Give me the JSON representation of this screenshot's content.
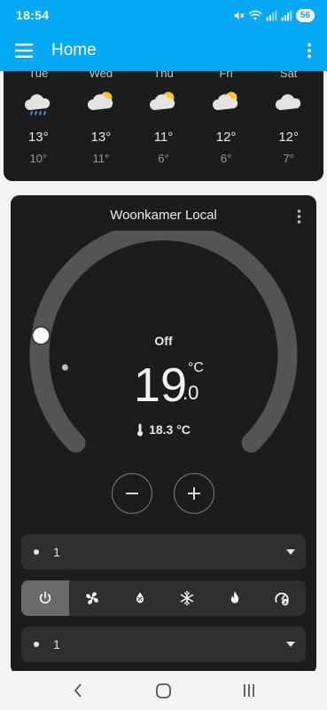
{
  "status_bar": {
    "time": "18:54",
    "battery": "56"
  },
  "app_bar": {
    "title": "Home"
  },
  "forecast": [
    {
      "day": "Tue",
      "icon": "rainy-icon",
      "high": "13°",
      "low": "10°"
    },
    {
      "day": "Wed",
      "icon": "partly-cloudy-icon",
      "high": "13°",
      "low": "11°"
    },
    {
      "day": "Thu",
      "icon": "partly-cloudy-icon",
      "high": "11°",
      "low": "6°"
    },
    {
      "day": "Fri",
      "icon": "partly-cloudy-icon",
      "high": "12°",
      "low": "6°"
    },
    {
      "day": "Sat",
      "icon": "cloudy-icon",
      "high": "12°",
      "low": "7°"
    }
  ],
  "thermostat": {
    "title": "Woonkamer Local",
    "hvac_state": "Off",
    "target_int": "19",
    "target_dec": ".0",
    "unit": "°C",
    "current": "18.3 °C",
    "target_level": 0.2,
    "current_level": 0.14
  },
  "selects": [
    {
      "value": "1"
    },
    {
      "value": "1"
    }
  ],
  "modes": [
    "power-icon",
    "fan-icon",
    "dry-icon",
    "snowflake-icon",
    "flame-icon",
    "auto-icon"
  ],
  "colors": {
    "accent": "#03a9f4",
    "card": "#1c1c1e",
    "track": "#545456"
  }
}
